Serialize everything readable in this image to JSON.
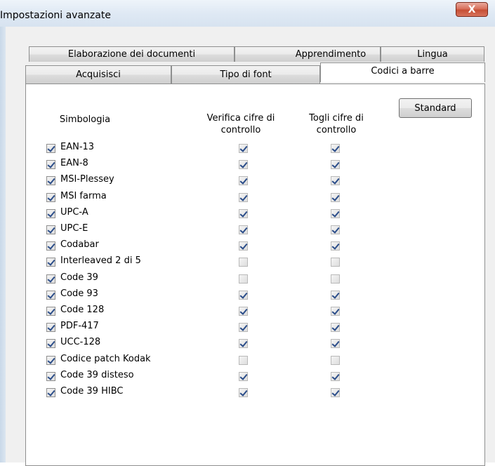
{
  "window": {
    "title": "Impostazioni avanzate",
    "close_label": "X"
  },
  "tabs": {
    "row1": [
      {
        "label": "Elaborazione dei documenti"
      },
      {
        "label": "Apprendimento"
      },
      {
        "label": "Lingua"
      }
    ],
    "row2": [
      {
        "label": "Acquisisci"
      },
      {
        "label": "Tipo di font"
      },
      {
        "label": "Codici a barre",
        "active": true
      }
    ]
  },
  "panel": {
    "standard_button": "Standard",
    "headers": {
      "symbology": "Simbologia",
      "verify_line1": "Verifica cifre di",
      "verify_line2": "controllo",
      "strip_line1": "Togli cifre di",
      "strip_line2": "controllo"
    },
    "rows": [
      {
        "name": "EAN-13",
        "enabled": true,
        "verify": true,
        "strip": true
      },
      {
        "name": "EAN-8",
        "enabled": true,
        "verify": true,
        "strip": true
      },
      {
        "name": "MSI-Plessey",
        "enabled": true,
        "verify": true,
        "strip": true
      },
      {
        "name": "MSI farma",
        "enabled": true,
        "verify": true,
        "strip": true
      },
      {
        "name": "UPC-A",
        "enabled": true,
        "verify": true,
        "strip": true
      },
      {
        "name": "UPC-E",
        "enabled": true,
        "verify": true,
        "strip": true
      },
      {
        "name": "Codabar",
        "enabled": true,
        "verify": true,
        "strip": true
      },
      {
        "name": "Interleaved 2 di 5",
        "enabled": true,
        "verify": false,
        "strip": false
      },
      {
        "name": "Code 39",
        "enabled": true,
        "verify": false,
        "strip": false
      },
      {
        "name": "Code 93",
        "enabled": true,
        "verify": true,
        "strip": true
      },
      {
        "name": "Code 128",
        "enabled": true,
        "verify": true,
        "strip": true
      },
      {
        "name": "PDF-417",
        "enabled": true,
        "verify": true,
        "strip": true
      },
      {
        "name": "UCC-128",
        "enabled": true,
        "verify": true,
        "strip": true
      },
      {
        "name": "Codice patch Kodak",
        "enabled": true,
        "verify": false,
        "strip": false
      },
      {
        "name": "Code 39 disteso",
        "enabled": true,
        "verify": true,
        "strip": true
      },
      {
        "name": "Code 39 HIBC",
        "enabled": true,
        "verify": true,
        "strip": true
      }
    ]
  }
}
